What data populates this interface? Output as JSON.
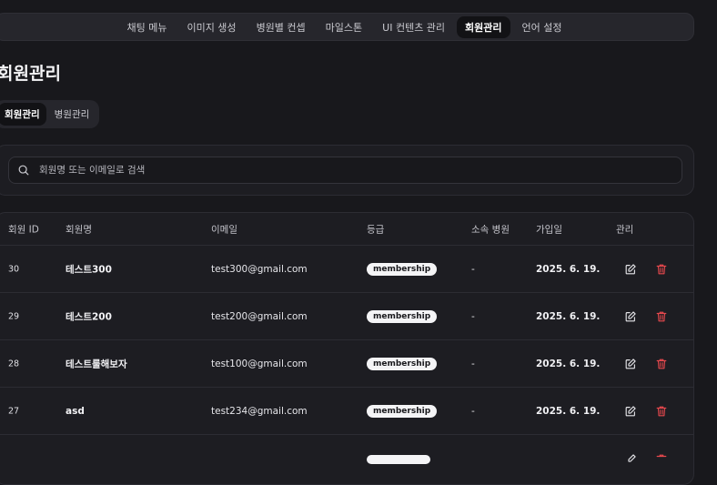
{
  "nav": {
    "items": [
      "채팅 메뉴",
      "이미지 생성",
      "병원별 컨셉",
      "마일스톤",
      "UI 컨텐츠 관리",
      "회원관리",
      "언어 설정"
    ],
    "active_index": 5
  },
  "page_title": "회원관리",
  "subtabs": {
    "items": [
      "회원관리",
      "병원관리"
    ],
    "active_index": 0
  },
  "search": {
    "placeholder": "회원명 또는 이메일로 검색",
    "value": ""
  },
  "table": {
    "headers": {
      "id": "회원 ID",
      "name": "회원명",
      "email": "이메일",
      "grade": "등급",
      "hospital": "소속 병원",
      "joined": "가입일",
      "manage": "관리"
    },
    "rows": [
      {
        "id": "30",
        "name": "테스트300",
        "email": "test300@gmail.com",
        "grade": "membership",
        "hospital": "-",
        "joined": "2025. 6. 19."
      },
      {
        "id": "29",
        "name": "테스트200",
        "email": "test200@gmail.com",
        "grade": "membership",
        "hospital": "-",
        "joined": "2025. 6. 19."
      },
      {
        "id": "28",
        "name": "테스트룰해보자",
        "email": "test100@gmail.com",
        "grade": "membership",
        "hospital": "-",
        "joined": "2025. 6. 19."
      },
      {
        "id": "27",
        "name": "asd",
        "email": "test234@gmail.com",
        "grade": "membership",
        "hospital": "-",
        "joined": "2025. 6. 19."
      },
      {
        "id": "",
        "name": "",
        "email": "",
        "grade": "",
        "hospital": "",
        "joined": ""
      }
    ],
    "icons": {
      "edit": "edit-icon",
      "delete": "trash-icon"
    }
  },
  "colors": {
    "background": "#18181c",
    "panel": "#1d1d22",
    "danger": "#e5484d",
    "badge_bg": "#f4f4f6"
  }
}
